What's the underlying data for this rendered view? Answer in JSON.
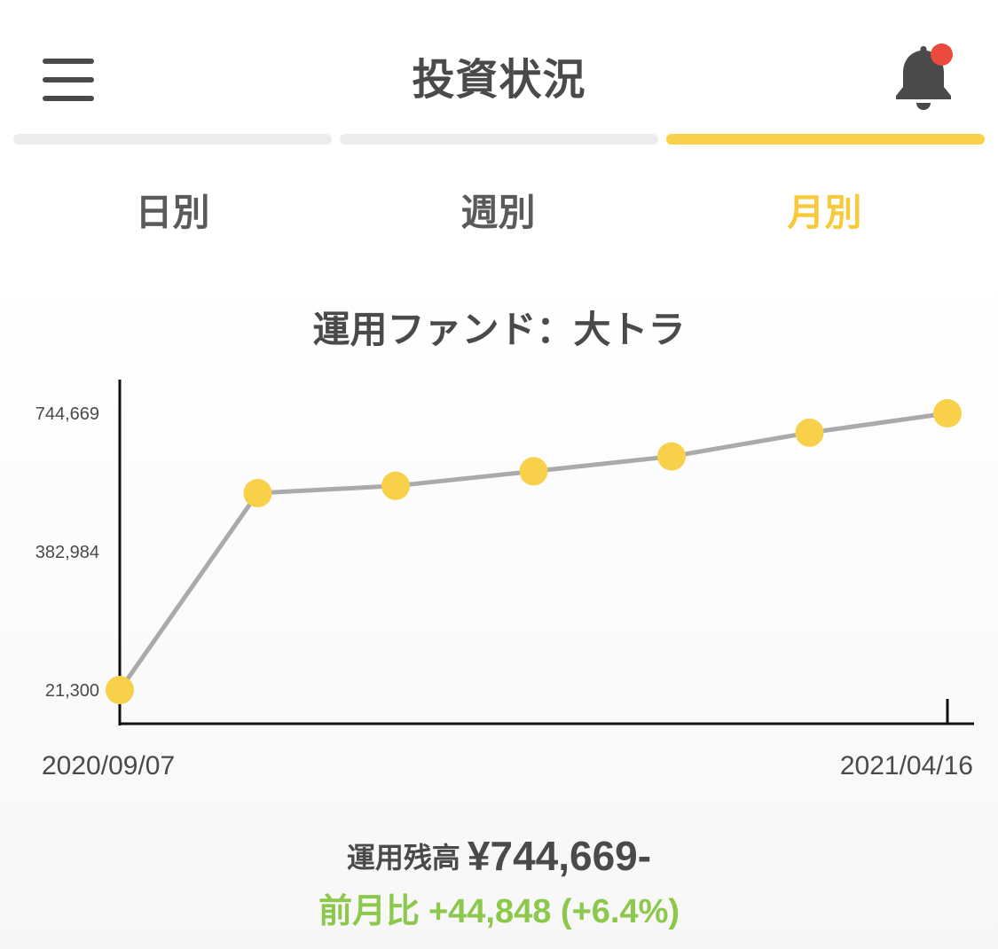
{
  "header": {
    "title": "投資状況",
    "menu_icon": "hamburger-menu-icon",
    "bell_icon": "bell-icon",
    "notification_dot_color": "#ea4b3c"
  },
  "tabs": [
    {
      "label": "日別",
      "active": false
    },
    {
      "label": "週別",
      "active": false
    },
    {
      "label": "月別",
      "active": true
    }
  ],
  "colors": {
    "accent": "#f8d04a",
    "line": "#aaaaaa",
    "positive": "#8cc84b",
    "text": "#4a4a4a"
  },
  "chart_data": {
    "type": "line",
    "title": "運用ファンド：大トラ",
    "x_labels": [
      "2020/09/07",
      "2021/04/16"
    ],
    "y_ticks": [
      21300,
      382984,
      744669
    ],
    "y_tick_labels": [
      "21,300",
      "382,984",
      "744,669"
    ],
    "ylim": [
      21300,
      744669
    ],
    "series": [
      {
        "values": [
          21300,
          536000,
          555000,
          593000,
          632000,
          694000,
          744669
        ]
      }
    ],
    "grid": false,
    "legend": "none"
  },
  "summary": {
    "balance_label": "運用残高",
    "balance_value": "¥744,669-",
    "change_label": "前月比",
    "change_value": "+44,848 (+6.4%)"
  }
}
